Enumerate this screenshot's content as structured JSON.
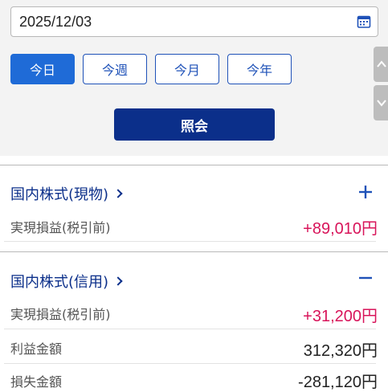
{
  "filter": {
    "date_value": "2025/12/03",
    "periods": [
      {
        "label": "今日",
        "active": true
      },
      {
        "label": "今週",
        "active": false
      },
      {
        "label": "今月",
        "active": false
      },
      {
        "label": "今年",
        "active": false
      }
    ],
    "query_label": "照会"
  },
  "sections": [
    {
      "title": "国内株式(現物)",
      "state": "collapsed",
      "rows": [
        {
          "label": "実現損益(税引前)",
          "value": "+89,010円"
        }
      ]
    },
    {
      "title": "国内株式(信用)",
      "state": "expanded",
      "rows": [
        {
          "label": "実現損益(税引前)",
          "value": "+31,200円"
        },
        {
          "label": "利益金額",
          "value": "312,320円"
        },
        {
          "label": "損失金額",
          "value": "-281,120円"
        }
      ]
    }
  ],
  "colors": {
    "primary": "#0b2f8a",
    "accent": "#1f6bd7",
    "positive": "#d8145a",
    "panel_bg": "#f3f3f3"
  },
  "icons": {
    "calendar": "calendar-icon",
    "expand": "plus-icon",
    "collapse": "minus-icon",
    "scroll_up": "chevron-up-icon",
    "scroll_down": "chevron-down-icon"
  }
}
